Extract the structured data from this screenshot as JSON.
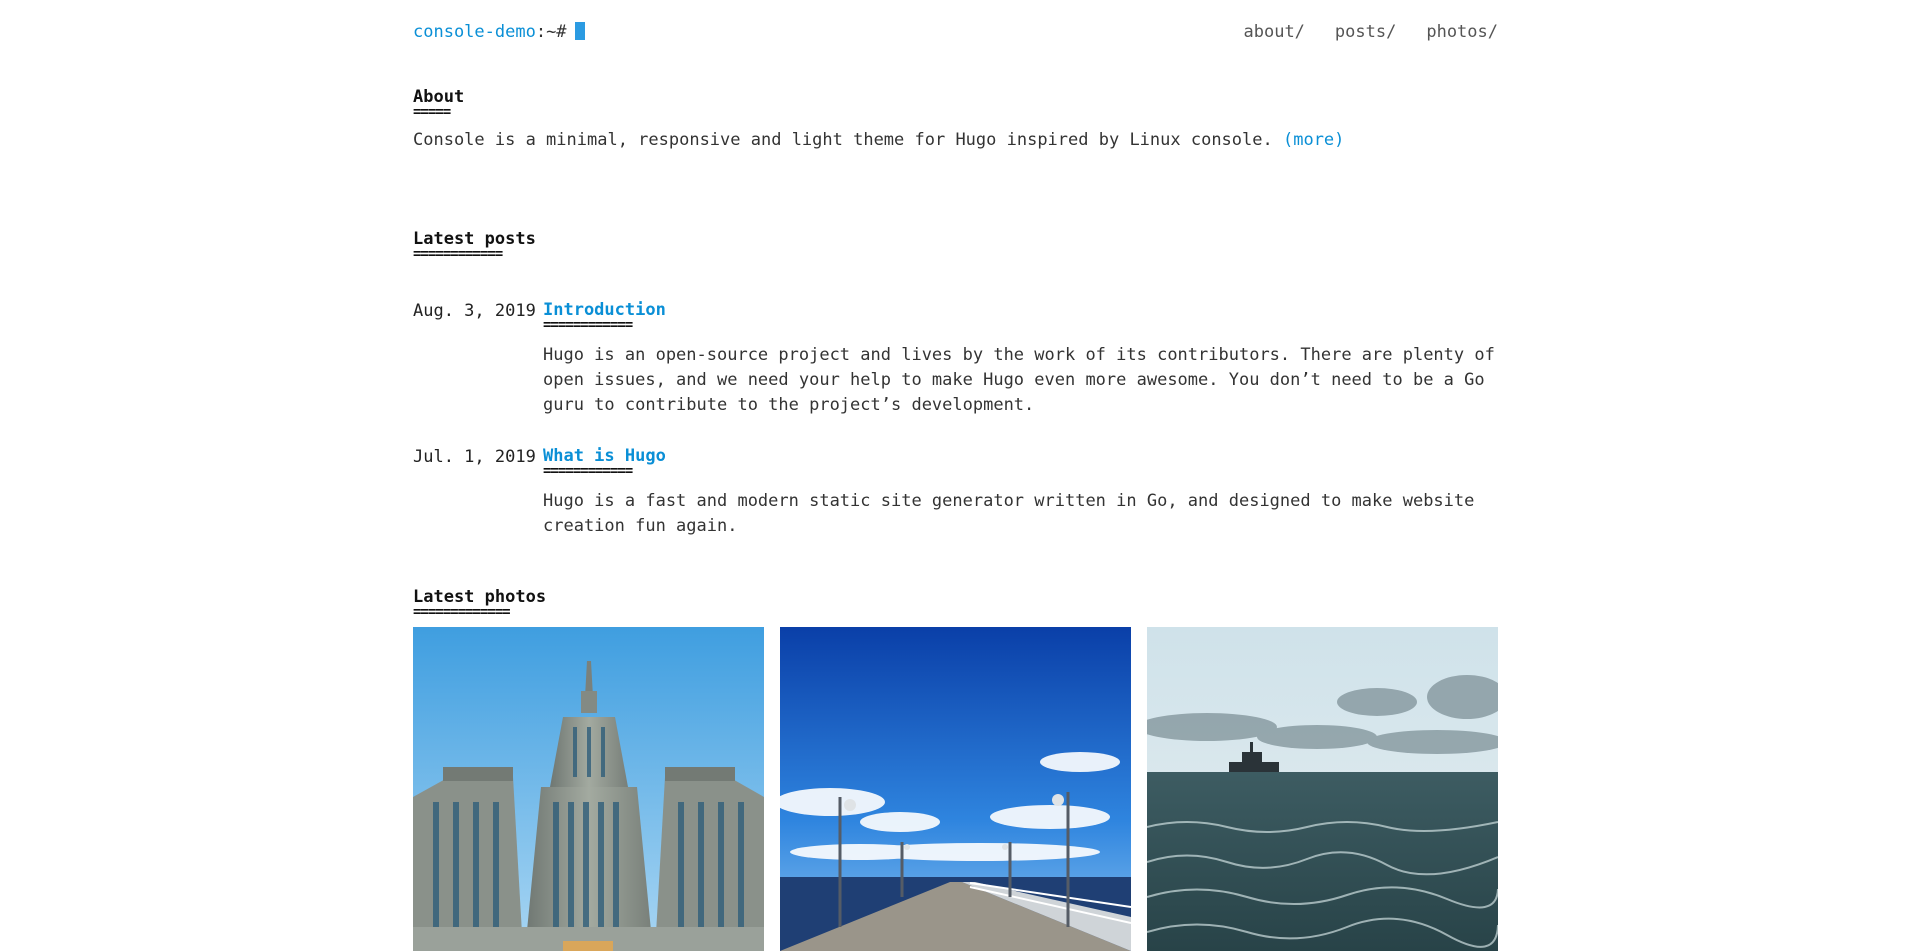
{
  "header": {
    "site_name": "console-demo",
    "prompt": ":~#",
    "nav": [
      "about/",
      "posts/",
      "photos/"
    ]
  },
  "about": {
    "title": "About",
    "underline": "=====",
    "text": "Console is a minimal, responsive and light theme for Hugo inspired by Linux console.",
    "more_link": "(more)"
  },
  "latest_posts": {
    "title": "Latest posts",
    "underline": "============",
    "items": [
      {
        "date": "Aug. 3, 2019",
        "title": "Introduction",
        "underline": "============",
        "summary": "Hugo is an open-source project and lives by the work of its contributors. There are plenty of open issues, and we need your help to make Hugo even more awesome. You don’t need to be a Go guru to contribute to the project’s development."
      },
      {
        "date": "Jul. 1, 2019",
        "title": "What is Hugo",
        "underline": "============",
        "summary": "Hugo is a fast and modern static site generator written in Go, and designed to make website creation fun again."
      }
    ]
  },
  "latest_photos": {
    "title": "Latest photos",
    "underline": "=============",
    "items": [
      {
        "icon": "tower-building-photo"
      },
      {
        "icon": "pier-photo"
      },
      {
        "icon": "sea-ship-photo"
      }
    ]
  },
  "colors": {
    "accent": "#0a8fd6",
    "cursor": "#2b9be2",
    "text": "#333333"
  }
}
